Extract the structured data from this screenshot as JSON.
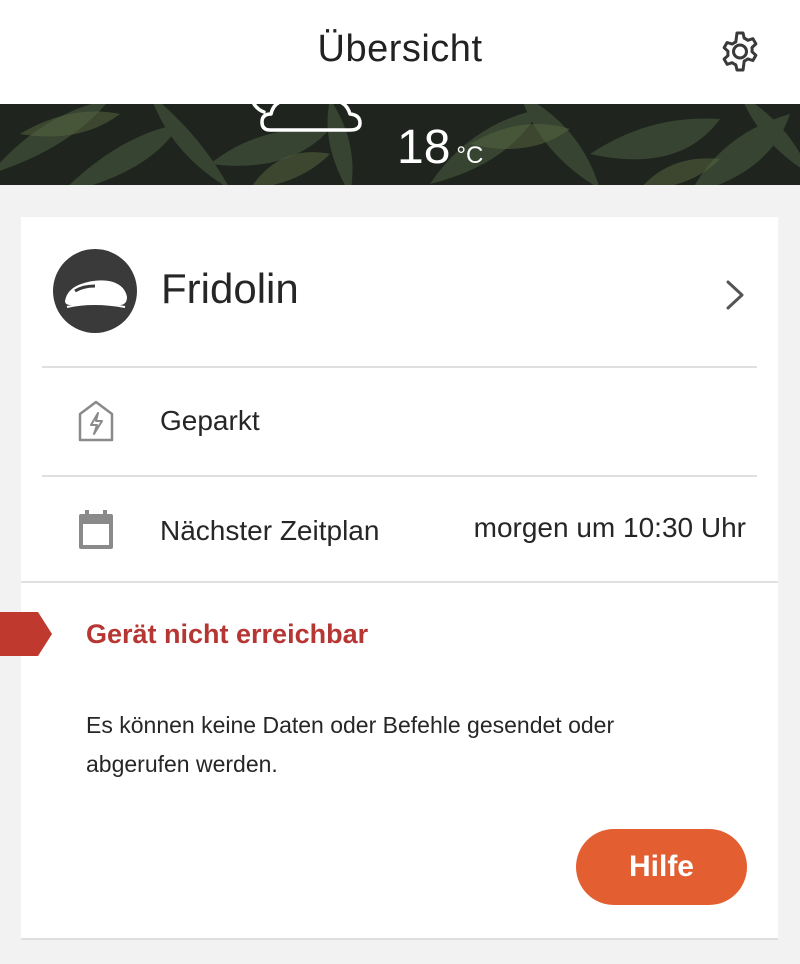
{
  "header": {
    "title": "Übersicht",
    "settings_icon": "gear-icon"
  },
  "weather": {
    "icon": "cloud-icon",
    "temperature": "18",
    "unit": "°C"
  },
  "device": {
    "name": "Fridolin",
    "icon": "mower-icon",
    "chevron_icon": "chevron-right-icon"
  },
  "status": {
    "icon": "charging-station-icon",
    "label": "Geparkt"
  },
  "schedule": {
    "icon": "calendar-icon",
    "label": "Nächster Zeitplan",
    "value": "morgen um 10:30 Uhr"
  },
  "alert": {
    "title": "Gerät nicht erreichbar",
    "message": "Es können keine Daten oder Befehle gesendet oder abgerufen werden.",
    "help_label": "Hilfe"
  },
  "colors": {
    "alert_red": "#b53632",
    "help_orange": "#e35f32",
    "avatar_dark": "#3a3a3a"
  }
}
